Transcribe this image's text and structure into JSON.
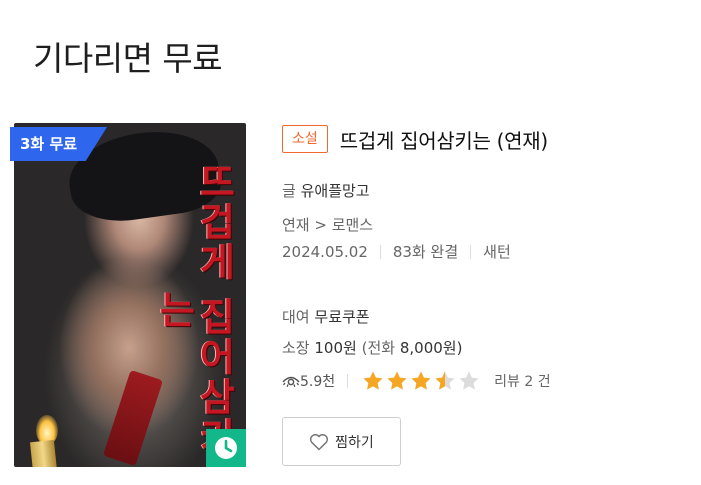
{
  "section": {
    "title": "기다리면 무료"
  },
  "cover": {
    "badge": "3화 무료",
    "title_art": "뜨겁게 집어삼키는",
    "wait_icon": "clock-icon"
  },
  "book": {
    "genre_tag": "소설",
    "title": "뜨겁게 집어삼키는 (연재)",
    "author_label": "글",
    "author": "유애플망고",
    "category": "연재 > 로맨스",
    "date": "2024.05.02",
    "episodes": "83화 완결",
    "publisher": "새턴",
    "rent_label": "대여",
    "rent_value": "무료쿠폰",
    "own_label": "소장",
    "own_value": "100원",
    "own_extra_open": "(전화",
    "own_extra_price": "8,000원)",
    "views": "5.9천",
    "rating": 3.5,
    "rating_max": 5,
    "reviews": "리뷰 2 건",
    "wish_label": "찜하기"
  },
  "colors": {
    "accent_orange": "#f0692f",
    "badge_blue": "#2f66ee",
    "wait_green": "#12b889",
    "star_on": "#f5a623",
    "star_off": "#dcdcdc"
  }
}
